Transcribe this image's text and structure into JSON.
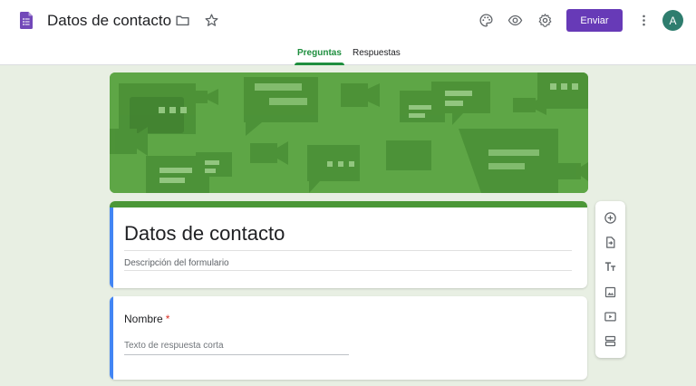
{
  "header": {
    "title": "Datos de contacto",
    "send_label": "Enviar",
    "avatar_initial": "A",
    "icons": [
      "forms-logo-icon",
      "folder-icon",
      "star-icon",
      "palette-icon",
      "preview-eye-icon",
      "settings-gear-icon",
      "more-vert-icon"
    ]
  },
  "tabs": [
    {
      "label": "Preguntas",
      "active": true
    },
    {
      "label": "Respuestas",
      "active": false
    }
  ],
  "form": {
    "title": "Datos de contacto",
    "description_placeholder": "Descripción del formulario"
  },
  "question": {
    "label": "Nombre",
    "required_mark": "*",
    "answer_placeholder": "Texto de respuesta corta"
  },
  "toolbar": {
    "items": [
      "add-question-icon",
      "import-questions-icon",
      "add-title-icon",
      "add-image-icon",
      "add-video-icon",
      "add-section-icon"
    ]
  },
  "colors": {
    "accent": "#673ab7",
    "theme_green": "#4b9737",
    "tab_active": "#1e8e3e",
    "focus_blue": "#4285f4",
    "background": "#e8efe3"
  }
}
